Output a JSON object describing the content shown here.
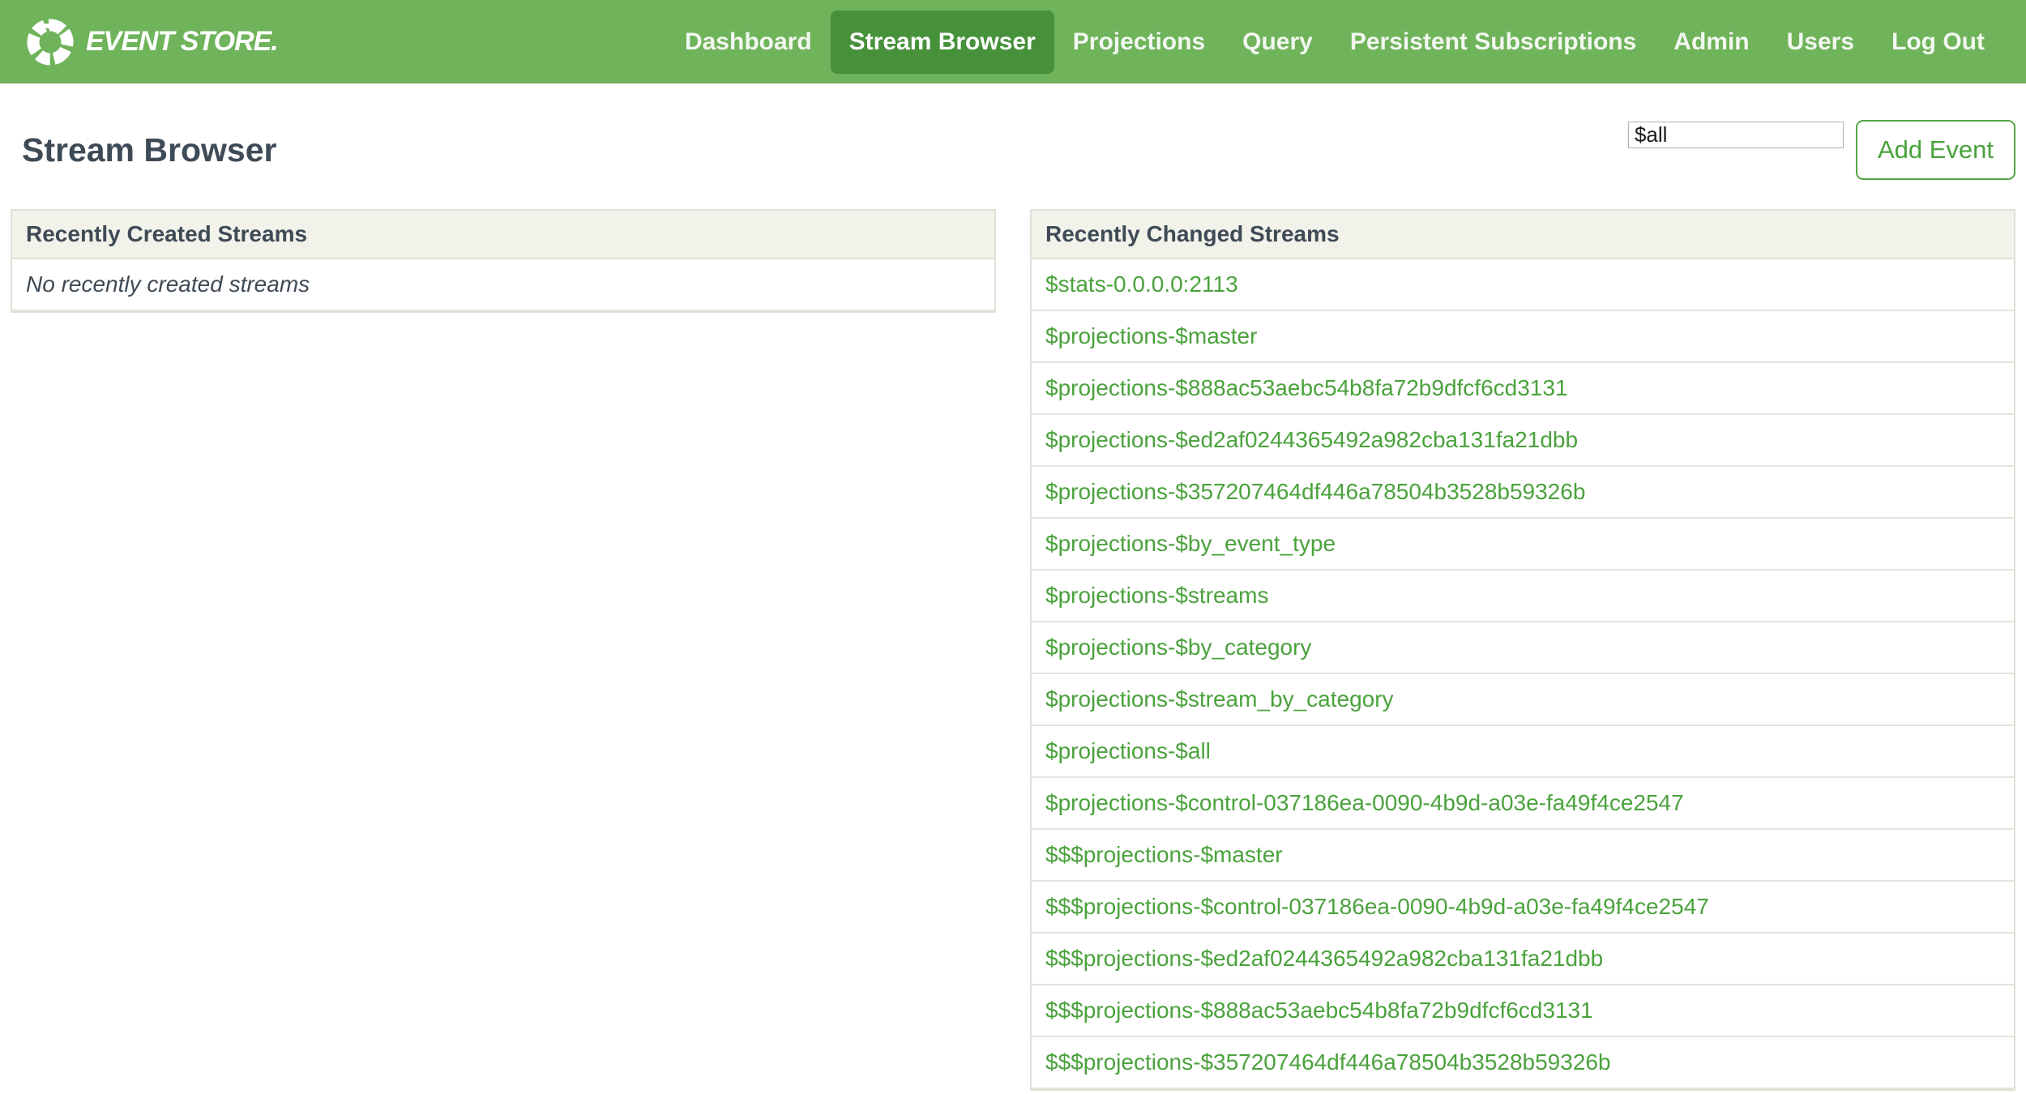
{
  "brand": {
    "name": "EVENT STORE."
  },
  "nav": {
    "items": [
      {
        "label": "Dashboard",
        "active": false
      },
      {
        "label": "Stream Browser",
        "active": true
      },
      {
        "label": "Projections",
        "active": false
      },
      {
        "label": "Query",
        "active": false
      },
      {
        "label": "Persistent Subscriptions",
        "active": false
      },
      {
        "label": "Admin",
        "active": false
      },
      {
        "label": "Users",
        "active": false
      },
      {
        "label": "Log Out",
        "active": false
      }
    ]
  },
  "page": {
    "title": "Stream Browser"
  },
  "toolbar": {
    "stream_input_value": "$all",
    "add_event_label": "Add Event"
  },
  "panels": {
    "created": {
      "title": "Recently Created Streams",
      "empty_message": "No recently created streams"
    },
    "changed": {
      "title": "Recently Changed Streams",
      "streams": [
        "$stats-0.0.0.0:2113",
        "$projections-$master",
        "$projections-$888ac53aebc54b8fa72b9dfcf6cd3131",
        "$projections-$ed2af0244365492a982cba131fa21dbb",
        "$projections-$357207464df446a78504b3528b59326b",
        "$projections-$by_event_type",
        "$projections-$streams",
        "$projections-$by_category",
        "$projections-$stream_by_category",
        "$projections-$all",
        "$projections-$control-037186ea-0090-4b9d-a03e-fa49f4ce2547",
        "$$$projections-$master",
        "$$$projections-$control-037186ea-0090-4b9d-a03e-fa49f4ce2547",
        "$$$projections-$ed2af0244365492a982cba131fa21dbb",
        "$$$projections-$888ac53aebc54b8fa72b9dfcf6cd3131",
        "$$$projections-$357207464df446a78504b3528b59326b"
      ]
    }
  },
  "colors": {
    "header_green": "#6fb35a",
    "active_nav_green": "#47913b",
    "link_green": "#4aa23c"
  }
}
